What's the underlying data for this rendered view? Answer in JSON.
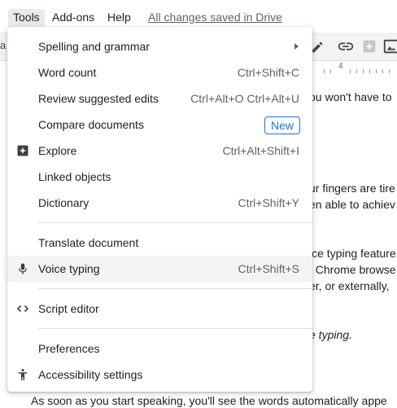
{
  "menubar": {
    "edge_glyph": ":",
    "tools": "Tools",
    "addons": "Add-ons",
    "help": "Help",
    "saved_status": "All changes saved in Drive"
  },
  "toolbar": {
    "left_fragment": "a",
    "icons": [
      "pencil-icon",
      "link-icon",
      "insert-comment-icon",
      "image-icon"
    ]
  },
  "ruler": {
    "number": "4"
  },
  "document": {
    "fragments": [
      "ou won't have to",
      "ur fingers are tire",
      "en able to achiev",
      "ice typing feature",
      ". Chrome browse",
      "er, or externally,",
      "e typing."
    ],
    "bottom_line": "As soon as you start speaking, you'll see the words automatically appe"
  },
  "menu": {
    "items": [
      {
        "label": "Spelling and grammar",
        "submenu": true
      },
      {
        "label": "Word count",
        "shortcut": "Ctrl+Shift+C"
      },
      {
        "label": "Review suggested edits",
        "shortcut": "Ctrl+Alt+O Ctrl+Alt+U"
      },
      {
        "label": "Compare documents",
        "badge": "New"
      },
      {
        "label": "Explore",
        "shortcut": "Ctrl+Alt+Shift+I",
        "icon": "explore-icon"
      },
      {
        "label": "Linked objects"
      },
      {
        "label": "Dictionary",
        "shortcut": "Ctrl+Shift+Y"
      },
      {
        "label": "Translate document"
      },
      {
        "label": "Voice typing",
        "shortcut": "Ctrl+Shift+S",
        "icon": "microphone-icon",
        "highlighted": true
      },
      {
        "label": "Script editor",
        "icon": "code-icon"
      },
      {
        "label": "Preferences"
      },
      {
        "label": "Accessibility settings",
        "icon": "accessibility-icon"
      }
    ]
  },
  "colors": {
    "accent": "#1a73e8",
    "menu_hover": "#f1f3f4",
    "divider": "#dadce0",
    "shortcut_text": "#5f6368"
  }
}
